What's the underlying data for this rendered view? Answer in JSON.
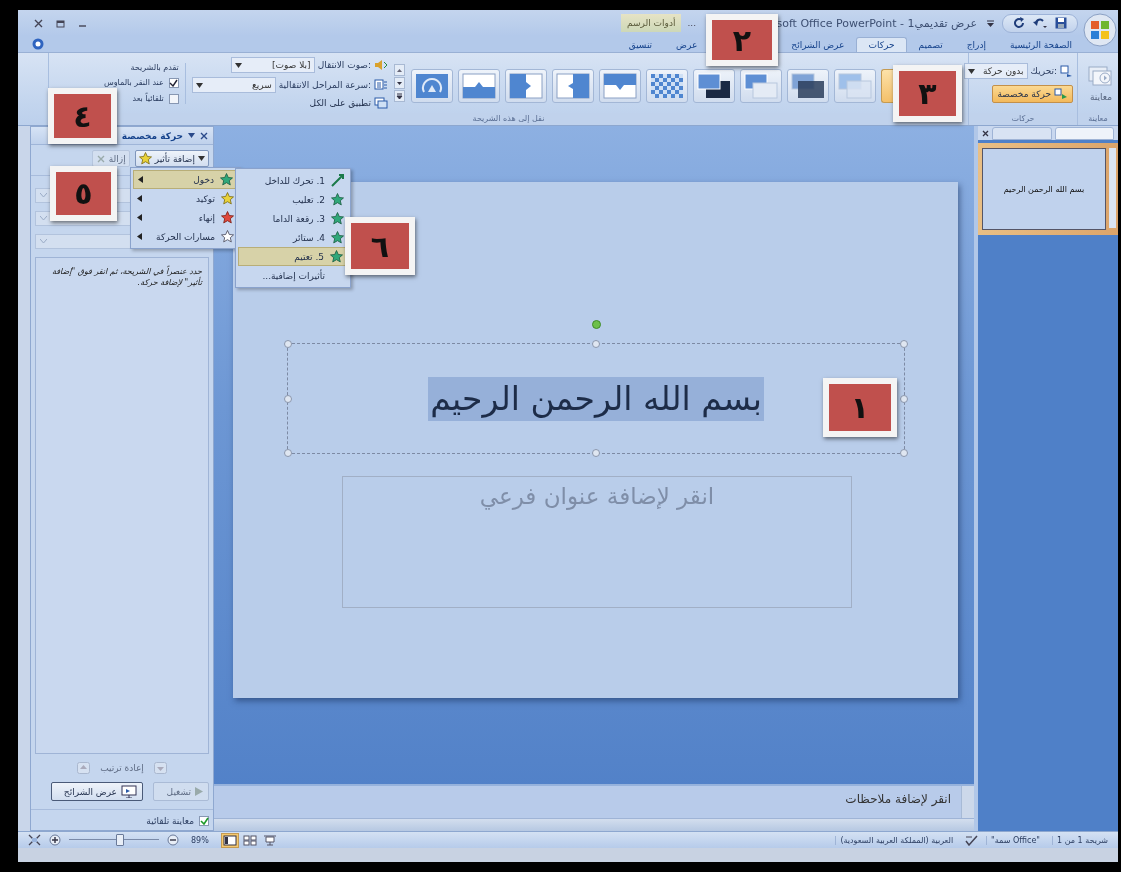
{
  "window": {
    "title": "soft Office PowerPoint - عرض تقديمي1",
    "title_ellipsis": "..."
  },
  "contextual_group": "أدوات الرسم",
  "tabs": [
    {
      "label": "الصفحة الرئيسية",
      "selected": false
    },
    {
      "label": "إدراج",
      "selected": false
    },
    {
      "label": "تصميم",
      "selected": false
    },
    {
      "label": "حركات",
      "selected": true
    },
    {
      "label": "عرض الشرائح",
      "selected": false
    },
    {
      "label": "عرض",
      "selected": false
    },
    {
      "label": "تنسيق",
      "selected": false
    }
  ],
  "ribbon": {
    "preview": {
      "button": "معاينة",
      "group_label": "معاينة"
    },
    "animations": {
      "group_label": "حركات",
      "animate_label": "تحريك:",
      "animate_value": "بدون حركة",
      "custom_button": "حركة مخصصة",
      "custom_pressed": true
    },
    "transitions": {
      "group_label": "نقل إلى هذه الشريحة",
      "gallery": [
        {
          "kind": "blank",
          "selected": true
        },
        {
          "kind": "fade",
          "selected": false
        },
        {
          "kind": "fade-dark",
          "selected": false
        },
        {
          "kind": "cut",
          "selected": false
        },
        {
          "kind": "cut-dark",
          "selected": false
        },
        {
          "kind": "dissolve",
          "selected": false
        },
        {
          "kind": "push-down",
          "selected": false
        },
        {
          "kind": "cover-left",
          "selected": false
        },
        {
          "kind": "push-right",
          "selected": false
        },
        {
          "kind": "wipe-up",
          "selected": false
        },
        {
          "kind": "wheel",
          "selected": false
        }
      ],
      "sound_label": "صوت الانتقال:",
      "sound_value": "[بلا صوت]",
      "speed_label": "سرعة المراحل الانتقالية:",
      "speed_value": "سريع",
      "apply_all": "تطبيق على الكل"
    },
    "advance": {
      "title": "تقدم بالشريحة",
      "options": [
        {
          "label": "عند النقر بالماوس",
          "checked": true
        },
        {
          "label": "تلقائياً بعد",
          "checked": false
        }
      ]
    }
  },
  "task_pane": {
    "title": "حركة مخصصة",
    "add_effect": "إضافة تأثير",
    "remove": "إزالة",
    "remove_disabled": true,
    "hint": "حدد عنصراً في الشريحة، ثم انقر فوق \"إضافة تأثير\" لإضافة حركة.",
    "reorder": "إعادة ترتيب",
    "play": "تشغيل",
    "play_disabled": true,
    "slide_show": "عرض الشرائح",
    "autopreview": {
      "label": "معاينة تلقائية",
      "checked": true
    }
  },
  "effect_menu": [
    {
      "label": "دخول",
      "kind": "entrance",
      "selected": true
    },
    {
      "label": "توكيد",
      "kind": "emphasis",
      "selected": false
    },
    {
      "label": "إنهاء",
      "kind": "exit",
      "selected": false
    },
    {
      "label": "مسارات الحركة",
      "kind": "path",
      "selected": false
    }
  ],
  "entrance_menu": [
    {
      "label": "1. تحرك للداخل",
      "kind": "fly",
      "selected": false
    },
    {
      "label": "2. تعليب",
      "kind": "star",
      "selected": false
    },
    {
      "label": "3. رقعة الداما",
      "kind": "star",
      "selected": false
    },
    {
      "label": "4. ستائر",
      "kind": "star",
      "selected": false
    },
    {
      "label": "5. تعتيم",
      "kind": "star",
      "selected": true
    },
    {
      "label": "تأثيرات إضافية...",
      "kind": "more",
      "selected": false
    }
  ],
  "slide": {
    "title": "بسم الله الرحمن الرحيم",
    "title_selected": true,
    "subtitle_prompt": "انقر لإضافة عنوان فرعي"
  },
  "notes": {
    "prompt": "انقر لإضافة ملاحظات"
  },
  "thumbnails": [
    {
      "text": "بسم الله الرحمن الرحيم",
      "selected": true
    }
  ],
  "status_bar": {
    "slide": "شريحة 1 من 1",
    "theme": "\"سمة Office\"",
    "language": "العربية (المملكة العربية السعودية)",
    "zoom": "89%",
    "zoom_slider": {
      "level": 0.55
    },
    "views": [
      {
        "kind": "normal",
        "selected": true
      },
      {
        "kind": "sorter",
        "selected": false
      },
      {
        "kind": "show",
        "selected": false
      }
    ]
  },
  "callouts": [
    "١",
    "٢",
    "٣",
    "٤",
    "٥",
    "٦"
  ]
}
